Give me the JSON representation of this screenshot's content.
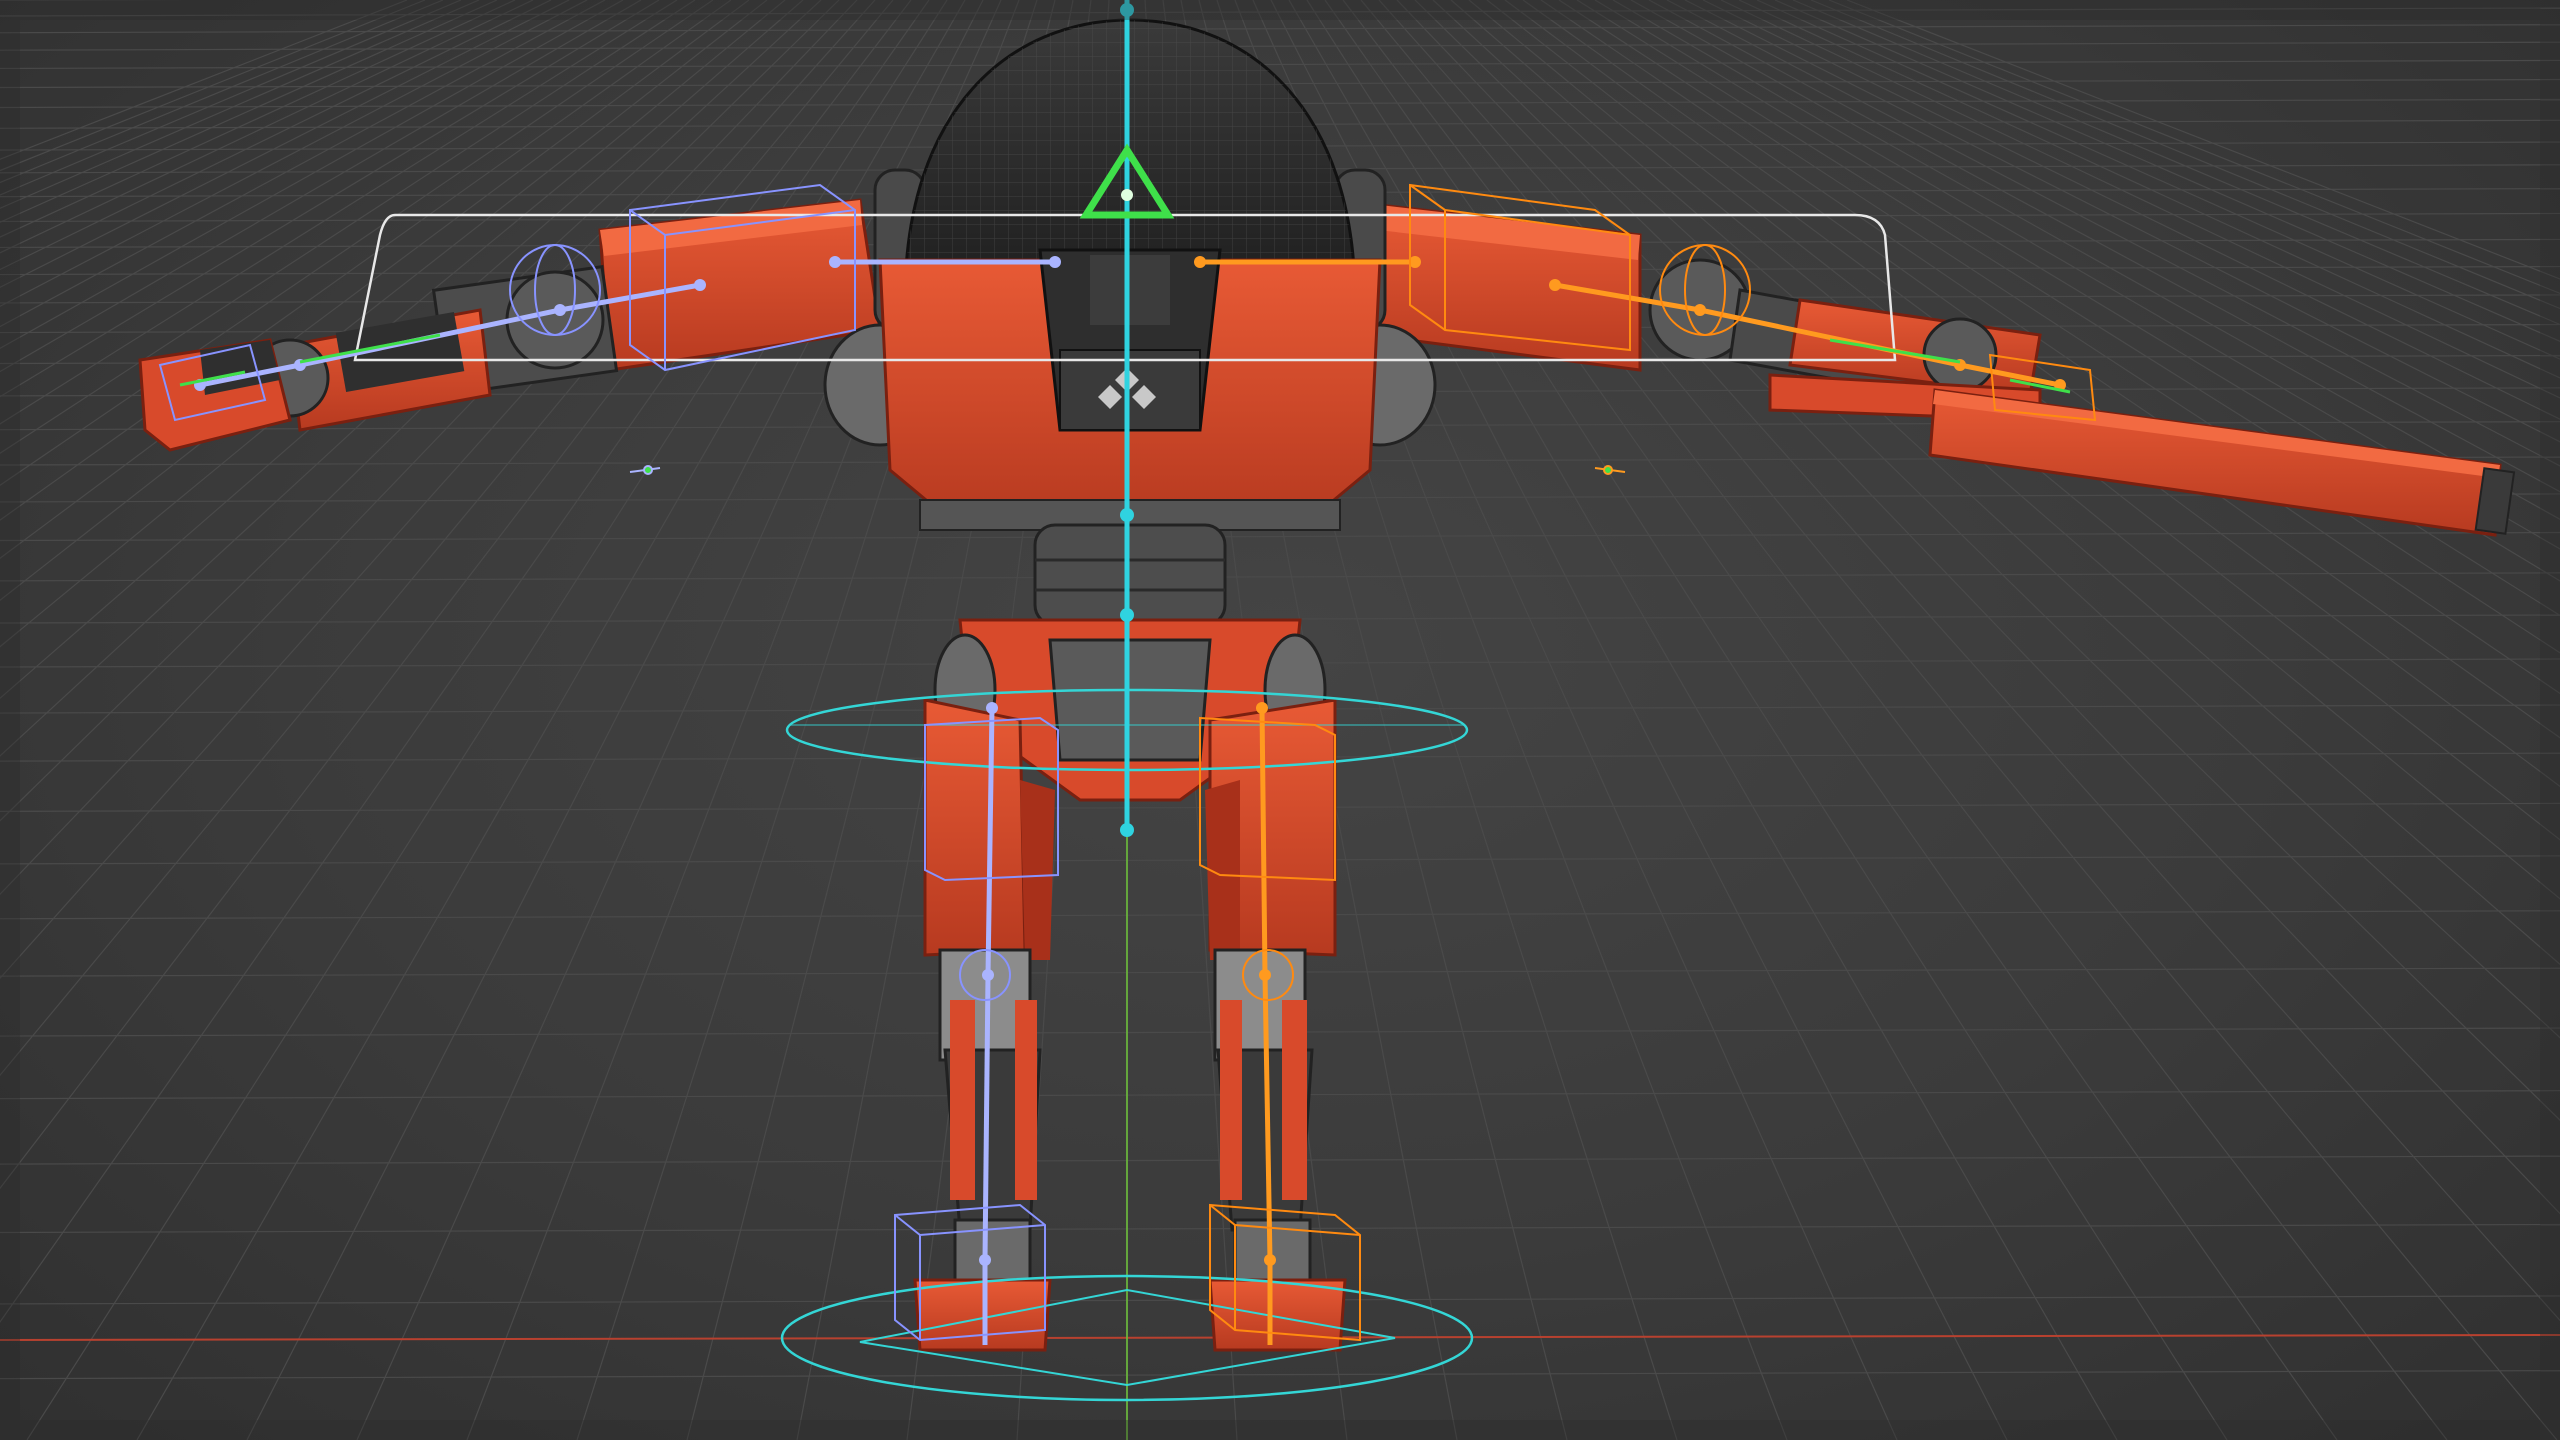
{
  "viewport": {
    "mode": "rig-wireframe-overlay",
    "colors": {
      "background": "#3a3a3a",
      "grid": "#4a4a4a",
      "axis_x": "#c0392b",
      "axis_z": "#6cbf3a",
      "armor": "#d84a2b",
      "armor_shadow": "#8f2a18",
      "joint_metal": "#5a5a5a",
      "helmet": "#2a2a2a",
      "bone_left": "#aab4ff",
      "bone_right": "#ff9a1f",
      "bone_spine": "#2fd3e0",
      "ik_control": "#34d6d6",
      "head_control": "#3fe04a",
      "shoulder_control": "#e8e8e8"
    },
    "icons": {
      "head_marker": "triangle-control-icon",
      "chest_logo": "diamond-logo-icon"
    }
  }
}
